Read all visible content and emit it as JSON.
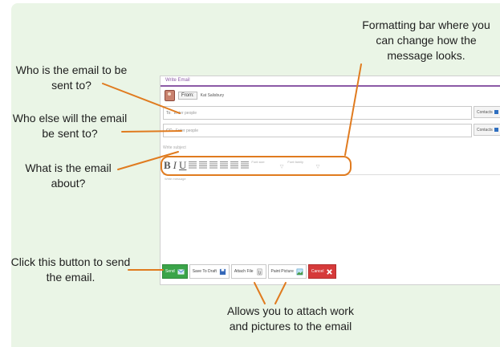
{
  "annotations": {
    "formatting_bar": "Formatting bar where you can change how the message looks.",
    "to_field": "Who is the email to be sent to?",
    "cc_field": "Who else will the email be sent to?",
    "subject": "What is the email about?",
    "send_button": "Click this button to send the email.",
    "attach_buttons": "Allows you to attach work and pictures to the email"
  },
  "email_window": {
    "title": "Write Email",
    "from_label": "From:",
    "from_name": "Kat Salisbury",
    "to_label": "To:",
    "to_placeholder": "Enter people",
    "cc_label": "CC:",
    "cc_placeholder": "Enter people",
    "contacts_label": "Contacts",
    "subject_placeholder": "Write subject",
    "font_size_label": "Font size",
    "font_family_label": "Font family",
    "message_placeholder": "Write message",
    "buttons": {
      "send": "Send",
      "save_draft": "Save To Draft",
      "attach_file": "Attach File",
      "paint_picture": "Paint Picture",
      "cancel": "Cancel"
    }
  },
  "colors": {
    "accent": "#8b5aa6",
    "arrow": "#e07b1f",
    "background": "#eaf5e6",
    "send": "#3aa449",
    "cancel": "#d63a3a"
  }
}
